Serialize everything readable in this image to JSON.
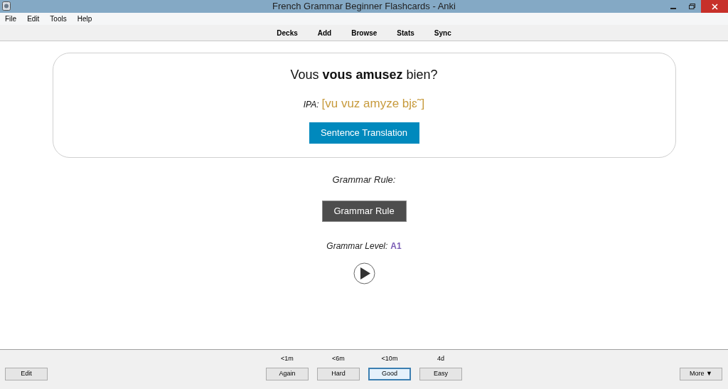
{
  "window": {
    "title": "French Grammar Beginner Flashcards - Anki"
  },
  "menu": [
    "File",
    "Edit",
    "Tools",
    "Help"
  ],
  "toolbar": [
    "Decks",
    "Add",
    "Browse",
    "Stats",
    "Sync"
  ],
  "card": {
    "question": "Vous **vous amusez** bien?",
    "ipa_label": "IPA:",
    "ipa": "[vu vuz amyze bjɛ˜]",
    "translation_button": "Sentence Translation"
  },
  "grammar_rule_label": "Grammar Rule:",
  "grammar_rule_button": "Grammar Rule",
  "grammar_level": {
    "label": "Grammar Level:",
    "value": "A1"
  },
  "bottom": {
    "edit": "Edit",
    "more": "More ▼",
    "answers": [
      {
        "interval": "<1m",
        "label": "Again",
        "selected": false
      },
      {
        "interval": "<6m",
        "label": "Hard",
        "selected": false
      },
      {
        "interval": "<10m",
        "label": "Good",
        "selected": true
      },
      {
        "interval": "4d",
        "label": "Easy",
        "selected": false
      }
    ]
  }
}
